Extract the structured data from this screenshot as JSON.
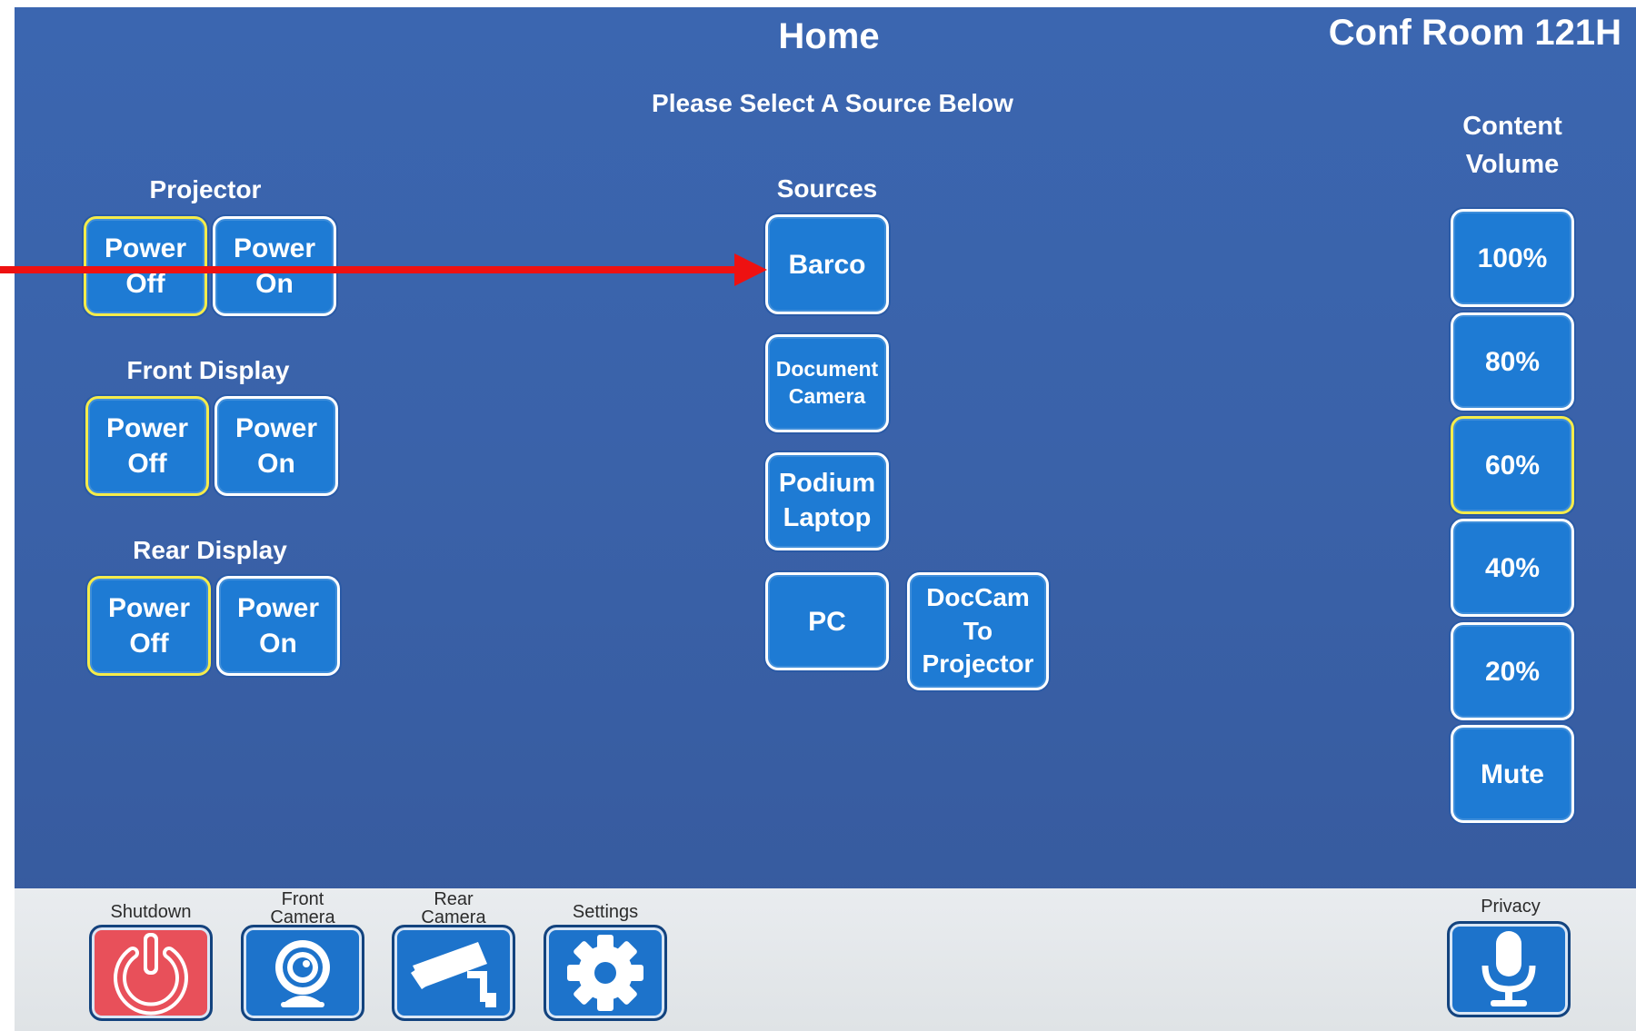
{
  "header": {
    "title": "Home",
    "room": "Conf Room 121H",
    "subtitle": "Please Select A Source Below"
  },
  "projector": {
    "label": "Projector",
    "off": [
      "Power",
      "Off"
    ],
    "on": [
      "Power",
      "On"
    ]
  },
  "front_display": {
    "label": "Front Display",
    "off": [
      "Power",
      "Off"
    ],
    "on": [
      "Power",
      "On"
    ]
  },
  "rear_display": {
    "label": "Rear Display",
    "off": [
      "Power",
      "Off"
    ],
    "on": [
      "Power",
      "On"
    ]
  },
  "sources": {
    "label": "Sources",
    "barco": "Barco",
    "document_camera": [
      "Document",
      "Camera"
    ],
    "podium_laptop": [
      "Podium",
      "Laptop"
    ],
    "pc": "PC",
    "doccam_to_projector": [
      "DocCam",
      "To",
      "Projector"
    ]
  },
  "volume": {
    "label": [
      "Content",
      "Volume"
    ],
    "levels": [
      "100%",
      "80%",
      "60%",
      "40%",
      "20%",
      "Mute"
    ],
    "selected": "60%"
  },
  "footer": {
    "shutdown": "Shutdown",
    "front_camera": [
      "Front",
      "Camera"
    ],
    "rear_camera": [
      "Rear",
      "Camera"
    ],
    "settings": "Settings",
    "privacy": "Privacy"
  },
  "annotation": {
    "arrow_color": "#ee1111"
  },
  "colors": {
    "background": "#3a62a9",
    "button": "#1e7bd4",
    "selected_border": "#f5ec4a",
    "shutdown": "#e8505a"
  }
}
